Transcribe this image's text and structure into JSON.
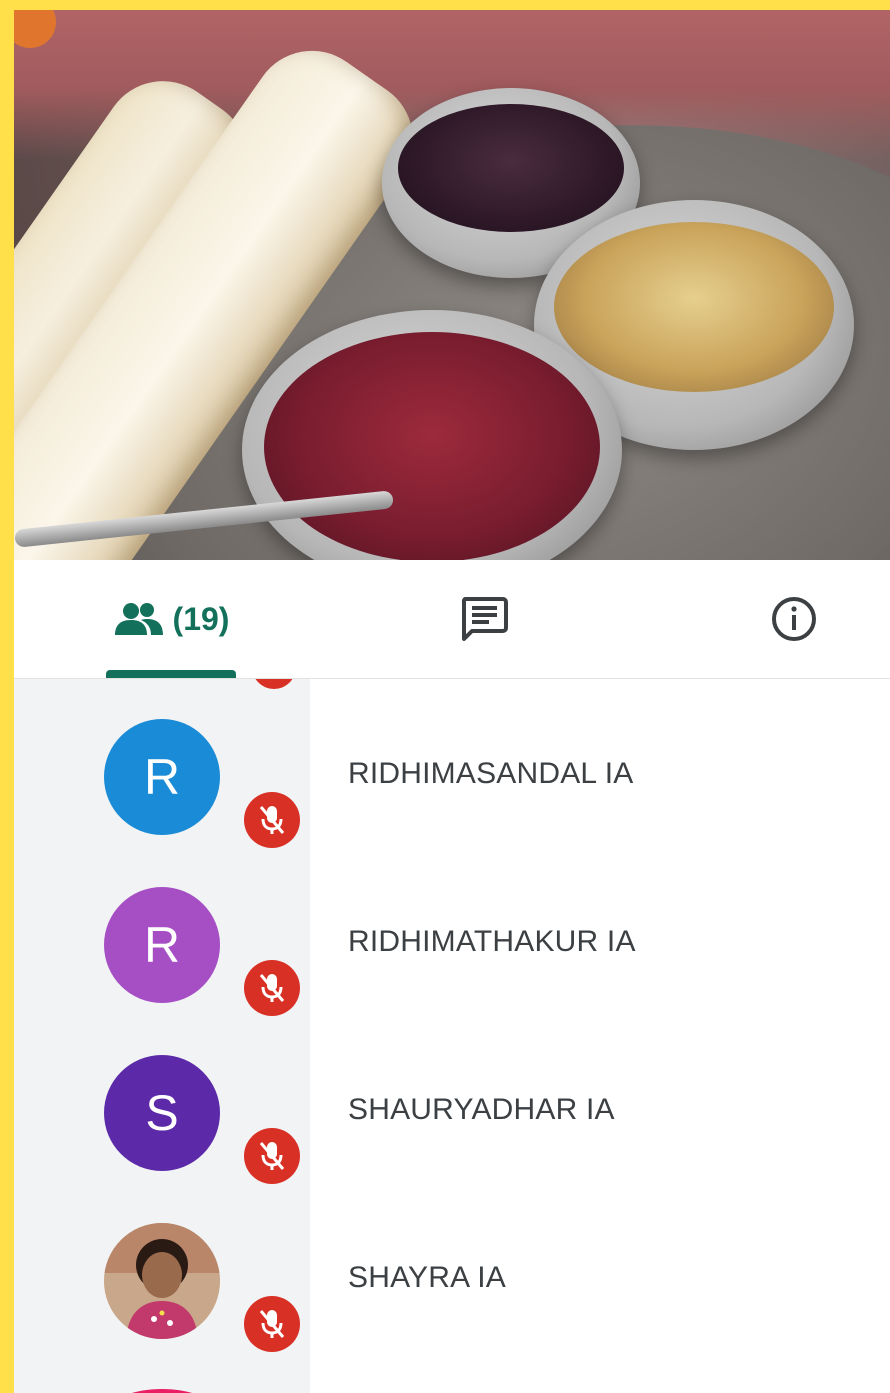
{
  "video": {
    "icon": "edit-icon"
  },
  "tabs": {
    "people": {
      "icon": "people-icon",
      "count_label": "(19)",
      "active": true,
      "color": "#12705B"
    },
    "chat": {
      "icon": "chat-icon"
    },
    "info": {
      "icon": "info-icon"
    }
  },
  "participants": [
    {
      "initial": "R",
      "name": "RIDHIMASANDAL IA",
      "avatar_color": "#1a8bd6",
      "muted": true
    },
    {
      "initial": "R",
      "name": "RIDHIMATHAKUR IA",
      "avatar_color": "#a64fc4",
      "muted": true
    },
    {
      "initial": "S",
      "name": "SHAURYADHAR IA",
      "avatar_color": "#5c2aa8",
      "muted": true
    },
    {
      "initial": "",
      "name": "SHAYRA IA",
      "avatar_color": "#d8c3b0",
      "muted": true,
      "photo": true
    }
  ],
  "colors": {
    "accent": "#12705B",
    "mute_red": "#d93025",
    "border_yellow": "#FFE04B"
  }
}
